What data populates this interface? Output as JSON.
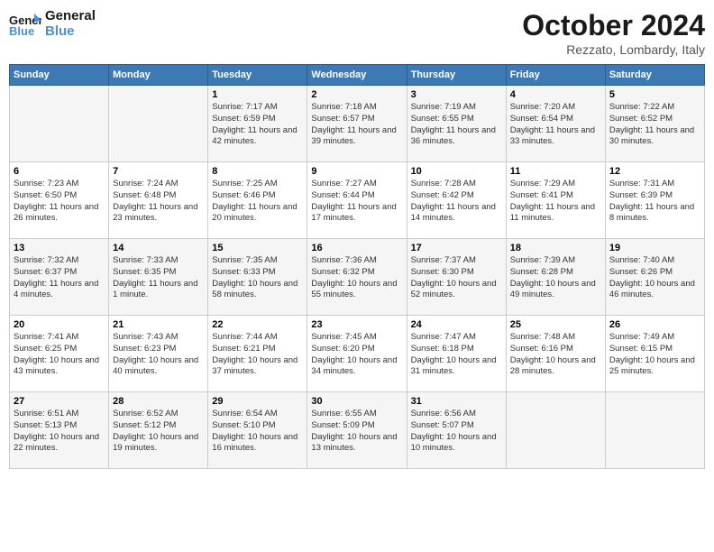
{
  "header": {
    "logo_general": "General",
    "logo_blue": "Blue",
    "month_title": "October 2024",
    "location": "Rezzato, Lombardy, Italy"
  },
  "weekdays": [
    "Sunday",
    "Monday",
    "Tuesday",
    "Wednesday",
    "Thursday",
    "Friday",
    "Saturday"
  ],
  "weeks": [
    [
      {
        "day": "",
        "info": ""
      },
      {
        "day": "",
        "info": ""
      },
      {
        "day": "1",
        "info": "Sunrise: 7:17 AM\nSunset: 6:59 PM\nDaylight: 11 hours and 42 minutes."
      },
      {
        "day": "2",
        "info": "Sunrise: 7:18 AM\nSunset: 6:57 PM\nDaylight: 11 hours and 39 minutes."
      },
      {
        "day": "3",
        "info": "Sunrise: 7:19 AM\nSunset: 6:55 PM\nDaylight: 11 hours and 36 minutes."
      },
      {
        "day": "4",
        "info": "Sunrise: 7:20 AM\nSunset: 6:54 PM\nDaylight: 11 hours and 33 minutes."
      },
      {
        "day": "5",
        "info": "Sunrise: 7:22 AM\nSunset: 6:52 PM\nDaylight: 11 hours and 30 minutes."
      }
    ],
    [
      {
        "day": "6",
        "info": "Sunrise: 7:23 AM\nSunset: 6:50 PM\nDaylight: 11 hours and 26 minutes."
      },
      {
        "day": "7",
        "info": "Sunrise: 7:24 AM\nSunset: 6:48 PM\nDaylight: 11 hours and 23 minutes."
      },
      {
        "day": "8",
        "info": "Sunrise: 7:25 AM\nSunset: 6:46 PM\nDaylight: 11 hours and 20 minutes."
      },
      {
        "day": "9",
        "info": "Sunrise: 7:27 AM\nSunset: 6:44 PM\nDaylight: 11 hours and 17 minutes."
      },
      {
        "day": "10",
        "info": "Sunrise: 7:28 AM\nSunset: 6:42 PM\nDaylight: 11 hours and 14 minutes."
      },
      {
        "day": "11",
        "info": "Sunrise: 7:29 AM\nSunset: 6:41 PM\nDaylight: 11 hours and 11 minutes."
      },
      {
        "day": "12",
        "info": "Sunrise: 7:31 AM\nSunset: 6:39 PM\nDaylight: 11 hours and 8 minutes."
      }
    ],
    [
      {
        "day": "13",
        "info": "Sunrise: 7:32 AM\nSunset: 6:37 PM\nDaylight: 11 hours and 4 minutes."
      },
      {
        "day": "14",
        "info": "Sunrise: 7:33 AM\nSunset: 6:35 PM\nDaylight: 11 hours and 1 minute."
      },
      {
        "day": "15",
        "info": "Sunrise: 7:35 AM\nSunset: 6:33 PM\nDaylight: 10 hours and 58 minutes."
      },
      {
        "day": "16",
        "info": "Sunrise: 7:36 AM\nSunset: 6:32 PM\nDaylight: 10 hours and 55 minutes."
      },
      {
        "day": "17",
        "info": "Sunrise: 7:37 AM\nSunset: 6:30 PM\nDaylight: 10 hours and 52 minutes."
      },
      {
        "day": "18",
        "info": "Sunrise: 7:39 AM\nSunset: 6:28 PM\nDaylight: 10 hours and 49 minutes."
      },
      {
        "day": "19",
        "info": "Sunrise: 7:40 AM\nSunset: 6:26 PM\nDaylight: 10 hours and 46 minutes."
      }
    ],
    [
      {
        "day": "20",
        "info": "Sunrise: 7:41 AM\nSunset: 6:25 PM\nDaylight: 10 hours and 43 minutes."
      },
      {
        "day": "21",
        "info": "Sunrise: 7:43 AM\nSunset: 6:23 PM\nDaylight: 10 hours and 40 minutes."
      },
      {
        "day": "22",
        "info": "Sunrise: 7:44 AM\nSunset: 6:21 PM\nDaylight: 10 hours and 37 minutes."
      },
      {
        "day": "23",
        "info": "Sunrise: 7:45 AM\nSunset: 6:20 PM\nDaylight: 10 hours and 34 minutes."
      },
      {
        "day": "24",
        "info": "Sunrise: 7:47 AM\nSunset: 6:18 PM\nDaylight: 10 hours and 31 minutes."
      },
      {
        "day": "25",
        "info": "Sunrise: 7:48 AM\nSunset: 6:16 PM\nDaylight: 10 hours and 28 minutes."
      },
      {
        "day": "26",
        "info": "Sunrise: 7:49 AM\nSunset: 6:15 PM\nDaylight: 10 hours and 25 minutes."
      }
    ],
    [
      {
        "day": "27",
        "info": "Sunrise: 6:51 AM\nSunset: 5:13 PM\nDaylight: 10 hours and 22 minutes."
      },
      {
        "day": "28",
        "info": "Sunrise: 6:52 AM\nSunset: 5:12 PM\nDaylight: 10 hours and 19 minutes."
      },
      {
        "day": "29",
        "info": "Sunrise: 6:54 AM\nSunset: 5:10 PM\nDaylight: 10 hours and 16 minutes."
      },
      {
        "day": "30",
        "info": "Sunrise: 6:55 AM\nSunset: 5:09 PM\nDaylight: 10 hours and 13 minutes."
      },
      {
        "day": "31",
        "info": "Sunrise: 6:56 AM\nSunset: 5:07 PM\nDaylight: 10 hours and 10 minutes."
      },
      {
        "day": "",
        "info": ""
      },
      {
        "day": "",
        "info": ""
      }
    ]
  ]
}
